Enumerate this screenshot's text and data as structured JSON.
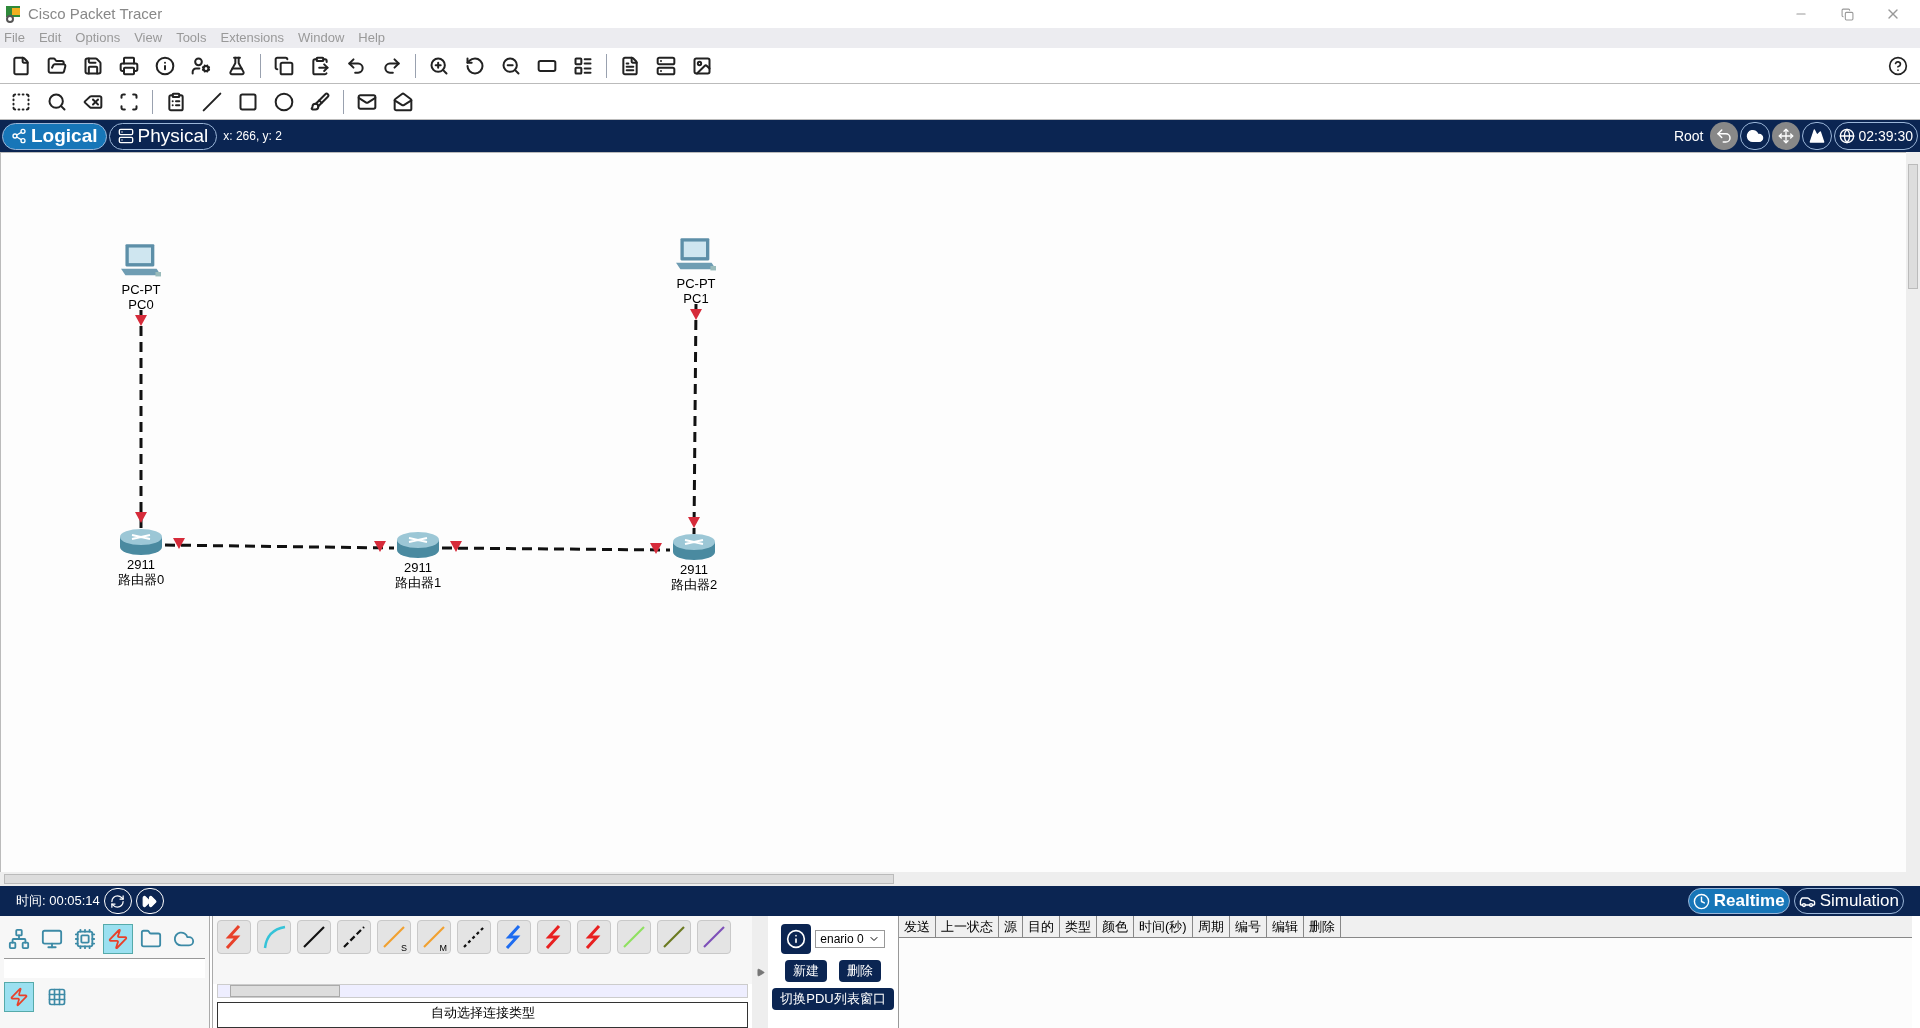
{
  "window": {
    "title": "Cisco Packet Tracer"
  },
  "menu": [
    "File",
    "Edit",
    "Options",
    "View",
    "Tools",
    "Extensions",
    "Window",
    "Help"
  ],
  "workspace_tabs": [
    {
      "label": "Logical",
      "selected": true
    },
    {
      "label": "Physical",
      "selected": false
    }
  ],
  "cursor_position": "x: 266, y: 2",
  "root_label": "Root",
  "clock": "02:39:30",
  "nodes": [
    {
      "kind": "pc",
      "model": "PC-PT",
      "name": "PC0"
    },
    {
      "kind": "pc",
      "model": "PC-PT",
      "name": "PC1"
    },
    {
      "kind": "router",
      "model": "2911",
      "name": "路由器0"
    },
    {
      "kind": "router",
      "model": "2911",
      "name": "路由器1"
    },
    {
      "kind": "router",
      "model": "2911",
      "name": "路由器2"
    }
  ],
  "links": [
    {
      "kind": "dashed"
    },
    {
      "kind": "dashed"
    },
    {
      "kind": "dashed"
    },
    {
      "kind": "dashed"
    }
  ],
  "sim_time": "时间: 00:05:14",
  "modes": [
    {
      "label": "Realtime",
      "selected": true
    },
    {
      "label": "Simulation",
      "selected": false
    }
  ],
  "device_categories": [
    {
      "kind": "network",
      "selected": false
    },
    {
      "kind": "end",
      "selected": false
    },
    {
      "kind": "component",
      "selected": false
    },
    {
      "kind": "connection",
      "selected": true
    },
    {
      "kind": "misc",
      "selected": false
    },
    {
      "kind": "multiuser",
      "selected": false
    }
  ],
  "sub_categories": [
    {
      "kind": "connection",
      "selected": true
    },
    {
      "kind": "grid",
      "selected": false
    }
  ],
  "cables": [
    {
      "kind": "auto"
    },
    {
      "kind": "console"
    },
    {
      "kind": "straight"
    },
    {
      "kind": "cross"
    },
    {
      "kind": "fiber",
      "mark": "S"
    },
    {
      "kind": "fiber",
      "mark": "M"
    },
    {
      "kind": "phone"
    },
    {
      "kind": "coax"
    },
    {
      "kind": "serial-dce"
    },
    {
      "kind": "serial-dte"
    },
    {
      "kind": "octal"
    },
    {
      "kind": "iot"
    },
    {
      "kind": "usb"
    }
  ],
  "cable_caption": "自动选择连接类型",
  "scenario": "enario 0",
  "pdu_buttons": [
    "新建",
    "删除"
  ],
  "pdu_toggle": "切换PDU列表窗口",
  "pdu_columns": [
    "发送",
    "上一状态",
    "源",
    "目的",
    "类型",
    "颜色",
    "时间(秒)",
    "周期",
    "编号",
    "编辑",
    "删除"
  ]
}
